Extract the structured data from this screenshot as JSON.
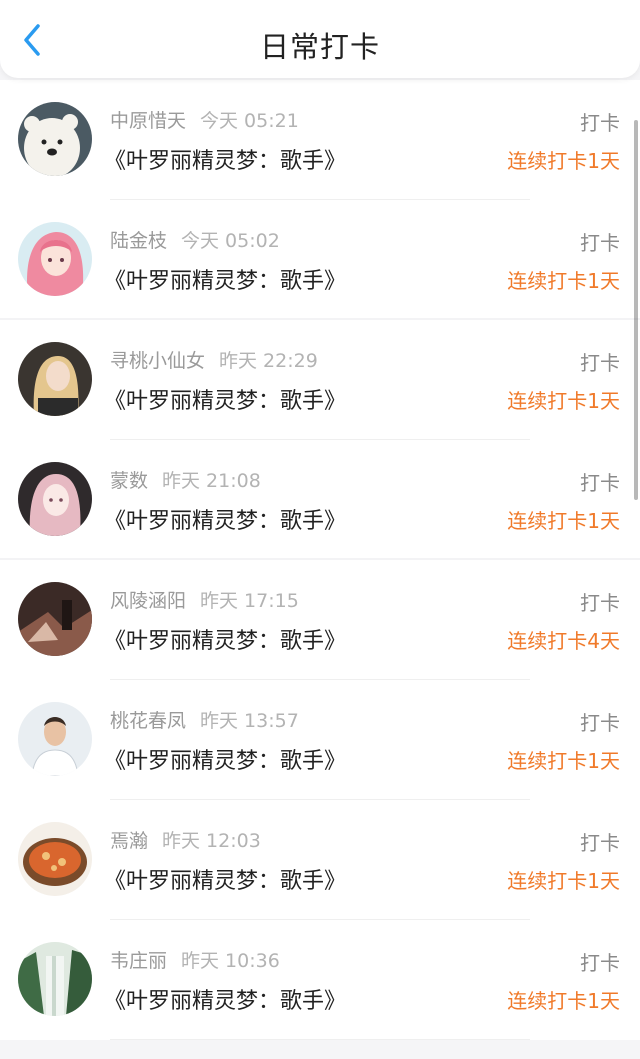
{
  "header": {
    "title": "日常打卡"
  },
  "colors": {
    "accent_blue": "#2a9bf0",
    "streak_orange": "#f07a2a"
  },
  "rows": [
    {
      "name": "中原惜天",
      "time": "今天 05:21",
      "book": "《叶罗丽精灵梦：歌手》",
      "action": "打卡",
      "streak": "连续打卡1天",
      "avatar": "bear-avatar"
    },
    {
      "name": "陆金枝",
      "time": "今天 05:02",
      "book": "《叶罗丽精灵梦：歌手》",
      "action": "打卡",
      "streak": "连续打卡1天",
      "avatar": "pink-hair-girl-avatar"
    },
    {
      "name": "寻桃小仙女",
      "time": "昨天 22:29",
      "book": "《叶罗丽精灵梦：歌手》",
      "action": "打卡",
      "streak": "连续打卡1天",
      "avatar": "blonde-woman-avatar"
    },
    {
      "name": "蒙数",
      "time": "昨天 21:08",
      "book": "《叶罗丽精灵梦：歌手》",
      "action": "打卡",
      "streak": "连续打卡1天",
      "avatar": "anime-girl-avatar"
    },
    {
      "name": "风陵涵阳",
      "time": "昨天 17:15",
      "book": "《叶罗丽精灵梦：歌手》",
      "action": "打卡",
      "streak": "连续打卡4天",
      "avatar": "dark-photo-avatar"
    },
    {
      "name": "桃花春凤",
      "time": "昨天 13:57",
      "book": "《叶罗丽精灵梦：歌手》",
      "action": "打卡",
      "streak": "连续打卡1天",
      "avatar": "man-portrait-avatar"
    },
    {
      "name": "焉瀚",
      "time": "昨天 12:03",
      "book": "《叶罗丽精灵梦：歌手》",
      "action": "打卡",
      "streak": "连续打卡1天",
      "avatar": "food-bowl-avatar"
    },
    {
      "name": "韦庄丽",
      "time": "昨天 10:36",
      "book": "《叶罗丽精灵梦：歌手》",
      "action": "打卡",
      "streak": "连续打卡1天",
      "avatar": "waterfall-avatar"
    }
  ]
}
